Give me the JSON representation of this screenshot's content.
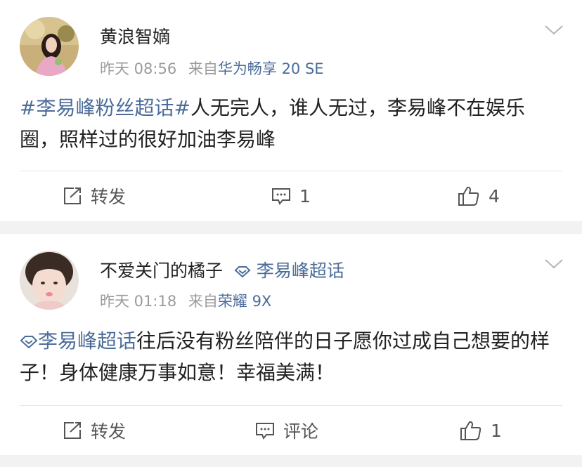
{
  "posts": [
    {
      "user": {
        "name": "黄浪智嫡"
      },
      "meta": {
        "time": "昨天 08:56",
        "from_prefix": "来自",
        "source": "华为畅享 20 SE"
      },
      "content": {
        "link": "#李易峰粉丝超话#",
        "text": "人无完人，谁人无过，李易峰不在娱乐圈，照样过的很好加油李易峰"
      },
      "actions": {
        "repost": "转发",
        "comment": "1",
        "like": "4"
      }
    },
    {
      "user": {
        "name": "不爱关门的橘子",
        "supertopic": "李易峰超话"
      },
      "meta": {
        "time": "昨天 01:18",
        "from_prefix": "来自",
        "source": "荣耀 9X"
      },
      "content": {
        "link": "李易峰超话",
        "text": "往后没有粉丝陪伴的日子愿你过成自己想要的样子！身体健康万事如意！幸福美满！"
      },
      "actions": {
        "repost": "转发",
        "comment": "评论",
        "like": "1"
      }
    }
  ],
  "colors": {
    "link": "#4c6d9a",
    "meta": "#9b9b9b",
    "background": "#f2f2f2"
  }
}
